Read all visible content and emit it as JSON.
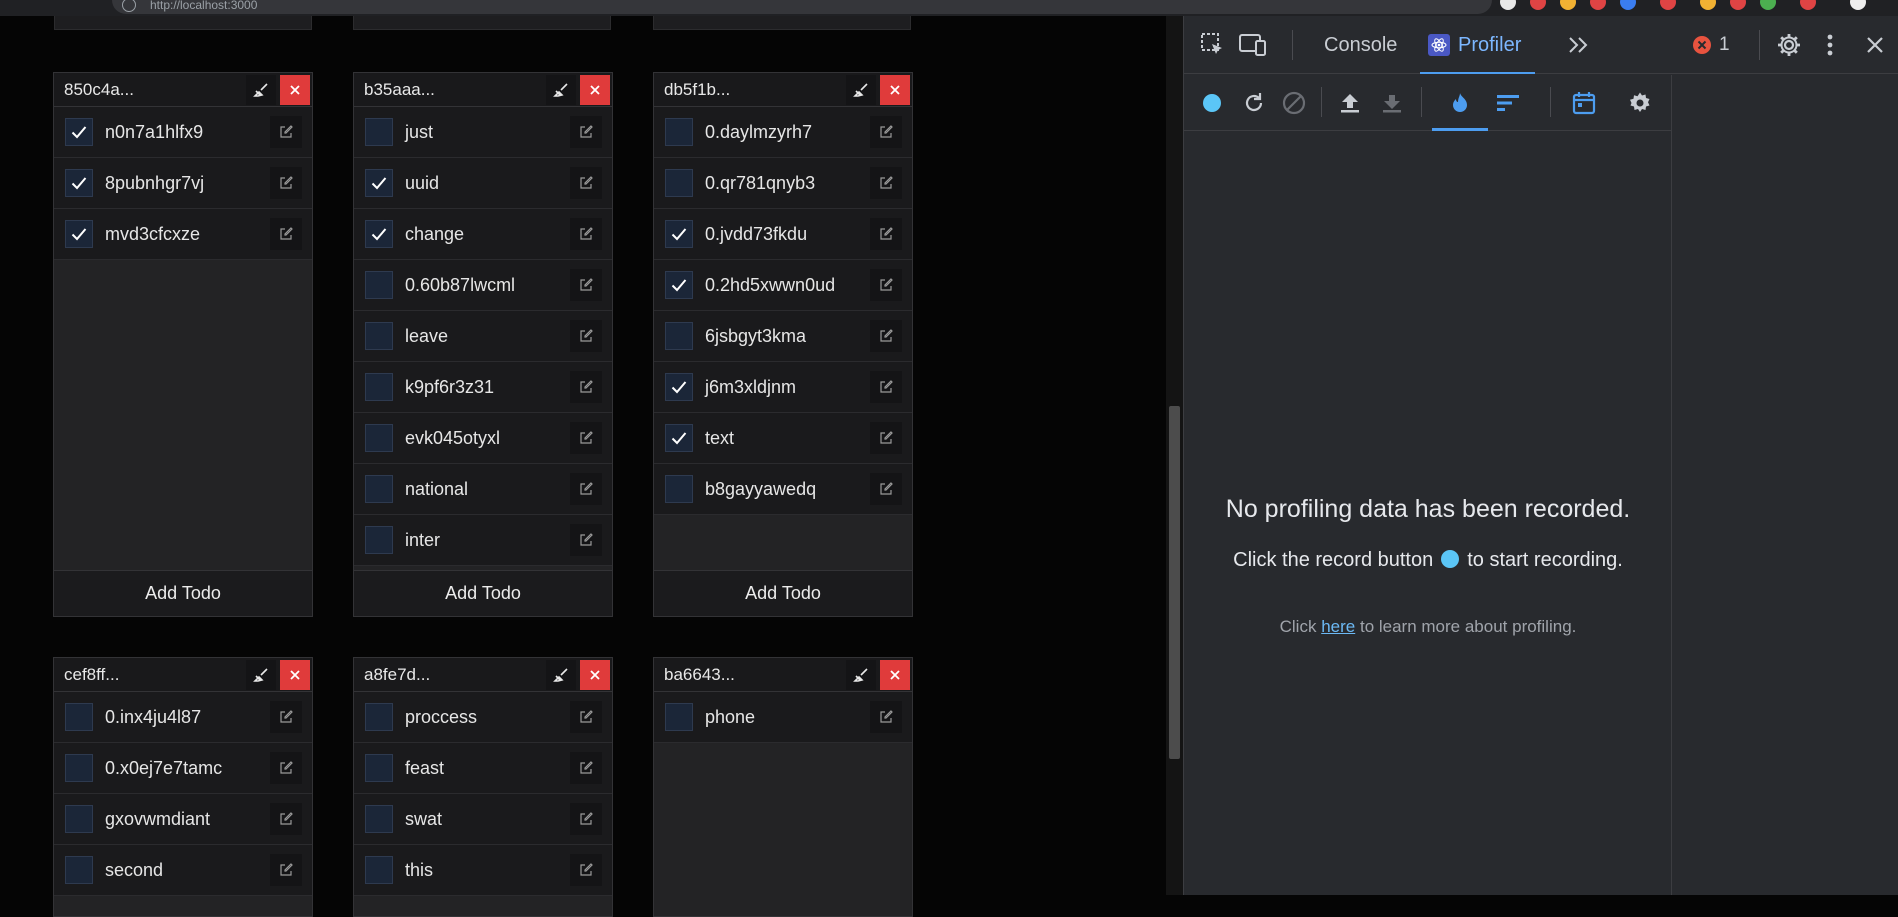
{
  "browser": {
    "url": "http://localhost:3000"
  },
  "boards": [
    {
      "title": "850c4a...",
      "add_label": "Add Todo",
      "todos": [
        {
          "text": "n0n7a1hlfx9",
          "checked": true
        },
        {
          "text": "8pubnhgr7vj",
          "checked": true
        },
        {
          "text": "mvd3cfcxze",
          "checked": true
        }
      ]
    },
    {
      "title": "b35aaa...",
      "add_label": "Add Todo",
      "todos": [
        {
          "text": "just",
          "checked": false
        },
        {
          "text": "uuid",
          "checked": true
        },
        {
          "text": "change",
          "checked": true
        },
        {
          "text": "0.60b87lwcml",
          "checked": false
        },
        {
          "text": "leave",
          "checked": false
        },
        {
          "text": "k9pf6r3z31",
          "checked": false
        },
        {
          "text": "evk045otyxl",
          "checked": false
        },
        {
          "text": "national",
          "checked": false
        },
        {
          "text": "inter",
          "checked": false
        }
      ]
    },
    {
      "title": "db5f1b...",
      "add_label": "Add Todo",
      "todos": [
        {
          "text": "0.daylmzyrh7",
          "checked": false
        },
        {
          "text": "0.qr781qnyb3",
          "checked": false
        },
        {
          "text": "0.jvdd73fkdu",
          "checked": true
        },
        {
          "text": "0.2hd5xwwn0ud",
          "checked": true
        },
        {
          "text": "6jsbgyt3kma",
          "checked": false
        },
        {
          "text": "j6m3xldjnm",
          "checked": true
        },
        {
          "text": "text",
          "checked": true
        },
        {
          "text": "b8gayyawedq",
          "checked": false
        }
      ]
    },
    {
      "title": "cef8ff...",
      "add_label": "",
      "todos": [
        {
          "text": "0.inx4ju4l87",
          "checked": false
        },
        {
          "text": "0.x0ej7e7tamc",
          "checked": false
        },
        {
          "text": "gxovwmdiant",
          "checked": false
        },
        {
          "text": "second",
          "checked": false
        }
      ]
    },
    {
      "title": "a8fe7d...",
      "add_label": "",
      "todos": [
        {
          "text": "proccess",
          "checked": false
        },
        {
          "text": "feast",
          "checked": false
        },
        {
          "text": "swat",
          "checked": false
        },
        {
          "text": "this",
          "checked": false
        }
      ]
    },
    {
      "title": "ba6643...",
      "add_label": "",
      "todos": [
        {
          "text": "phone",
          "checked": false
        }
      ]
    }
  ],
  "devtools": {
    "tabs": [
      {
        "label": "Console",
        "active": false
      },
      {
        "label": "Profiler",
        "active": true
      }
    ],
    "error_count": "1",
    "profiler": {
      "empty_title": "No profiling data has been recorded.",
      "record_hint_before": "Click the record button",
      "record_hint_after": "to start recording.",
      "learn_before": "Click",
      "learn_link": "here",
      "learn_after": "to learn more about profiling."
    }
  },
  "colors": {
    "accent_blue": "#4d9df0",
    "record_dot": "#5bc6f7",
    "close_red": "#e03b3b",
    "error_red": "#e8533f"
  }
}
